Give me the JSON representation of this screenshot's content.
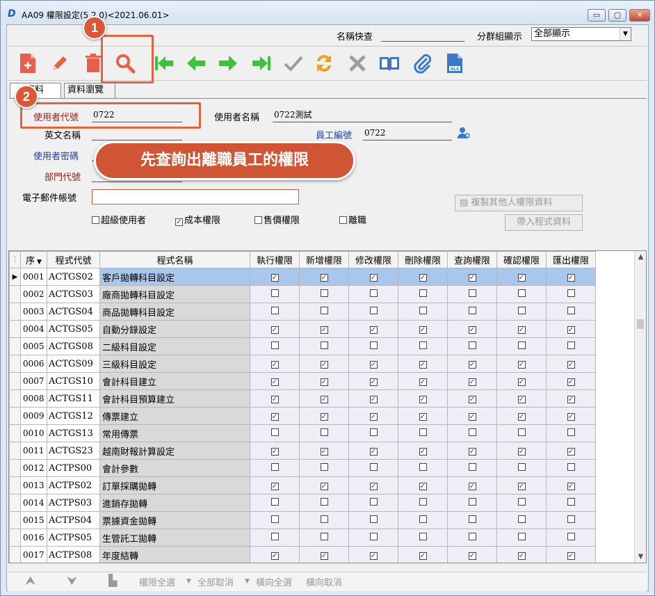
{
  "window": {
    "title": "AA09 權限設定(5.2.0)<2021.06.01>",
    "buttons": {
      "minimize": "▭",
      "maximize": "▢",
      "close": "✕"
    }
  },
  "quick": {
    "name_search_label": "名稱快查",
    "group_label": "分群組顯示",
    "group_value": "全部顯示"
  },
  "toolbar": {
    "icons": [
      "add-doc-icon",
      "edit-pencil-icon",
      "delete-trash-icon",
      "search-magnifier-icon",
      "first-arrow-icon",
      "prev-arrow-icon",
      "next-arrow-icon",
      "last-arrow-icon",
      "confirm-check-icon",
      "refresh-icon",
      "cancel-x-icon",
      "book-icon",
      "attachment-icon",
      "xls-export-icon"
    ]
  },
  "tabs": [
    {
      "label": "資料"
    },
    {
      "label": "資料瀏覽"
    }
  ],
  "form": {
    "user_code_label": "使用者代號",
    "user_code_value": "0722",
    "user_name_label": "使用者名稱",
    "user_name_value": "0722測試",
    "english_name_label": "英文名稱",
    "employee_no_label": "員工編號",
    "employee_no_value": "0722",
    "password_label": "使用者密碼",
    "dept_label": "部門代號",
    "email_label": "電子郵件帳號",
    "checks": [
      {
        "label": "超級使用者",
        "checked": false
      },
      {
        "label": "成本權限",
        "checked": true
      },
      {
        "label": "售價權限",
        "checked": false
      },
      {
        "label": "離職",
        "checked": false
      }
    ],
    "copy_button": "複製其他人權限資料",
    "load_button": "帶入程式資料"
  },
  "grid": {
    "headers": [
      "序",
      "程式代號",
      "程式名稱",
      "執行權限",
      "新增權限",
      "修改權限",
      "刪除權限",
      "查詢權限",
      "確認權限",
      "匯出權限"
    ],
    "rows": [
      {
        "seq": "0001",
        "code": "ACTGS02",
        "name": "客戶拋轉科目設定",
        "perms": [
          1,
          1,
          1,
          1,
          1,
          1,
          1
        ],
        "selected": true
      },
      {
        "seq": "0002",
        "code": "ACTGS03",
        "name": "廠商拋轉科目設定",
        "perms": [
          0,
          0,
          0,
          0,
          0,
          0,
          0
        ]
      },
      {
        "seq": "0003",
        "code": "ACTGS04",
        "name": "商品拋轉科目設定",
        "perms": [
          0,
          0,
          0,
          0,
          0,
          0,
          0
        ]
      },
      {
        "seq": "0004",
        "code": "ACTGS05",
        "name": "自動分錄設定",
        "perms": [
          1,
          1,
          1,
          1,
          1,
          1,
          1
        ]
      },
      {
        "seq": "0005",
        "code": "ACTGS08",
        "name": "二級科目設定",
        "perms": [
          0,
          0,
          0,
          0,
          0,
          0,
          0
        ]
      },
      {
        "seq": "0006",
        "code": "ACTGS09",
        "name": "三級科目設定",
        "perms": [
          1,
          1,
          1,
          1,
          1,
          1,
          1
        ]
      },
      {
        "seq": "0007",
        "code": "ACTGS10",
        "name": "會計科目建立",
        "perms": [
          1,
          1,
          1,
          1,
          1,
          1,
          1
        ]
      },
      {
        "seq": "0008",
        "code": "ACTGS11",
        "name": "會計科目預算建立",
        "perms": [
          1,
          1,
          1,
          1,
          1,
          1,
          1
        ]
      },
      {
        "seq": "0009",
        "code": "ACTGS12",
        "name": "傳票建立",
        "perms": [
          1,
          1,
          1,
          1,
          1,
          1,
          1
        ]
      },
      {
        "seq": "0010",
        "code": "ACTGS13",
        "name": "常用傳票",
        "perms": [
          0,
          0,
          0,
          0,
          0,
          0,
          0
        ]
      },
      {
        "seq": "0011",
        "code": "ACTGS23",
        "name": "越南財報計算設定",
        "perms": [
          1,
          1,
          1,
          1,
          1,
          1,
          1
        ]
      },
      {
        "seq": "0012",
        "code": "ACTPS00",
        "name": "會計參數",
        "perms": [
          0,
          0,
          0,
          0,
          0,
          0,
          0
        ]
      },
      {
        "seq": "0013",
        "code": "ACTPS02",
        "name": "訂單採購拋轉",
        "perms": [
          1,
          1,
          1,
          1,
          1,
          1,
          1
        ]
      },
      {
        "seq": "0014",
        "code": "ACTPS03",
        "name": "進銷存拋轉",
        "perms": [
          0,
          0,
          0,
          0,
          0,
          0,
          0
        ]
      },
      {
        "seq": "0015",
        "code": "ACTPS04",
        "name": "票據資金拋轉",
        "perms": [
          0,
          0,
          0,
          0,
          0,
          0,
          0
        ]
      },
      {
        "seq": "0016",
        "code": "ACTPS05",
        "name": "生管託工拋轉",
        "perms": [
          0,
          0,
          0,
          0,
          0,
          0,
          0
        ]
      },
      {
        "seq": "0017",
        "code": "ACTPS08",
        "name": "年度結轉",
        "perms": [
          1,
          1,
          1,
          1,
          1,
          1,
          1
        ]
      }
    ]
  },
  "bottombar": {
    "select_all": "權限全選",
    "cancel_all": "全部取消",
    "row_select": "橫向全選",
    "row_cancel": "橫向取消"
  },
  "callouts": {
    "step1": "1",
    "step2": "2",
    "banner": "先查詢出離職員工的權限"
  },
  "colors": {
    "accent_red": "#e0643f",
    "selected_row": "#a9c7ec",
    "label_red": "#9b1b1b",
    "label_blue": "#1f3fa8"
  }
}
